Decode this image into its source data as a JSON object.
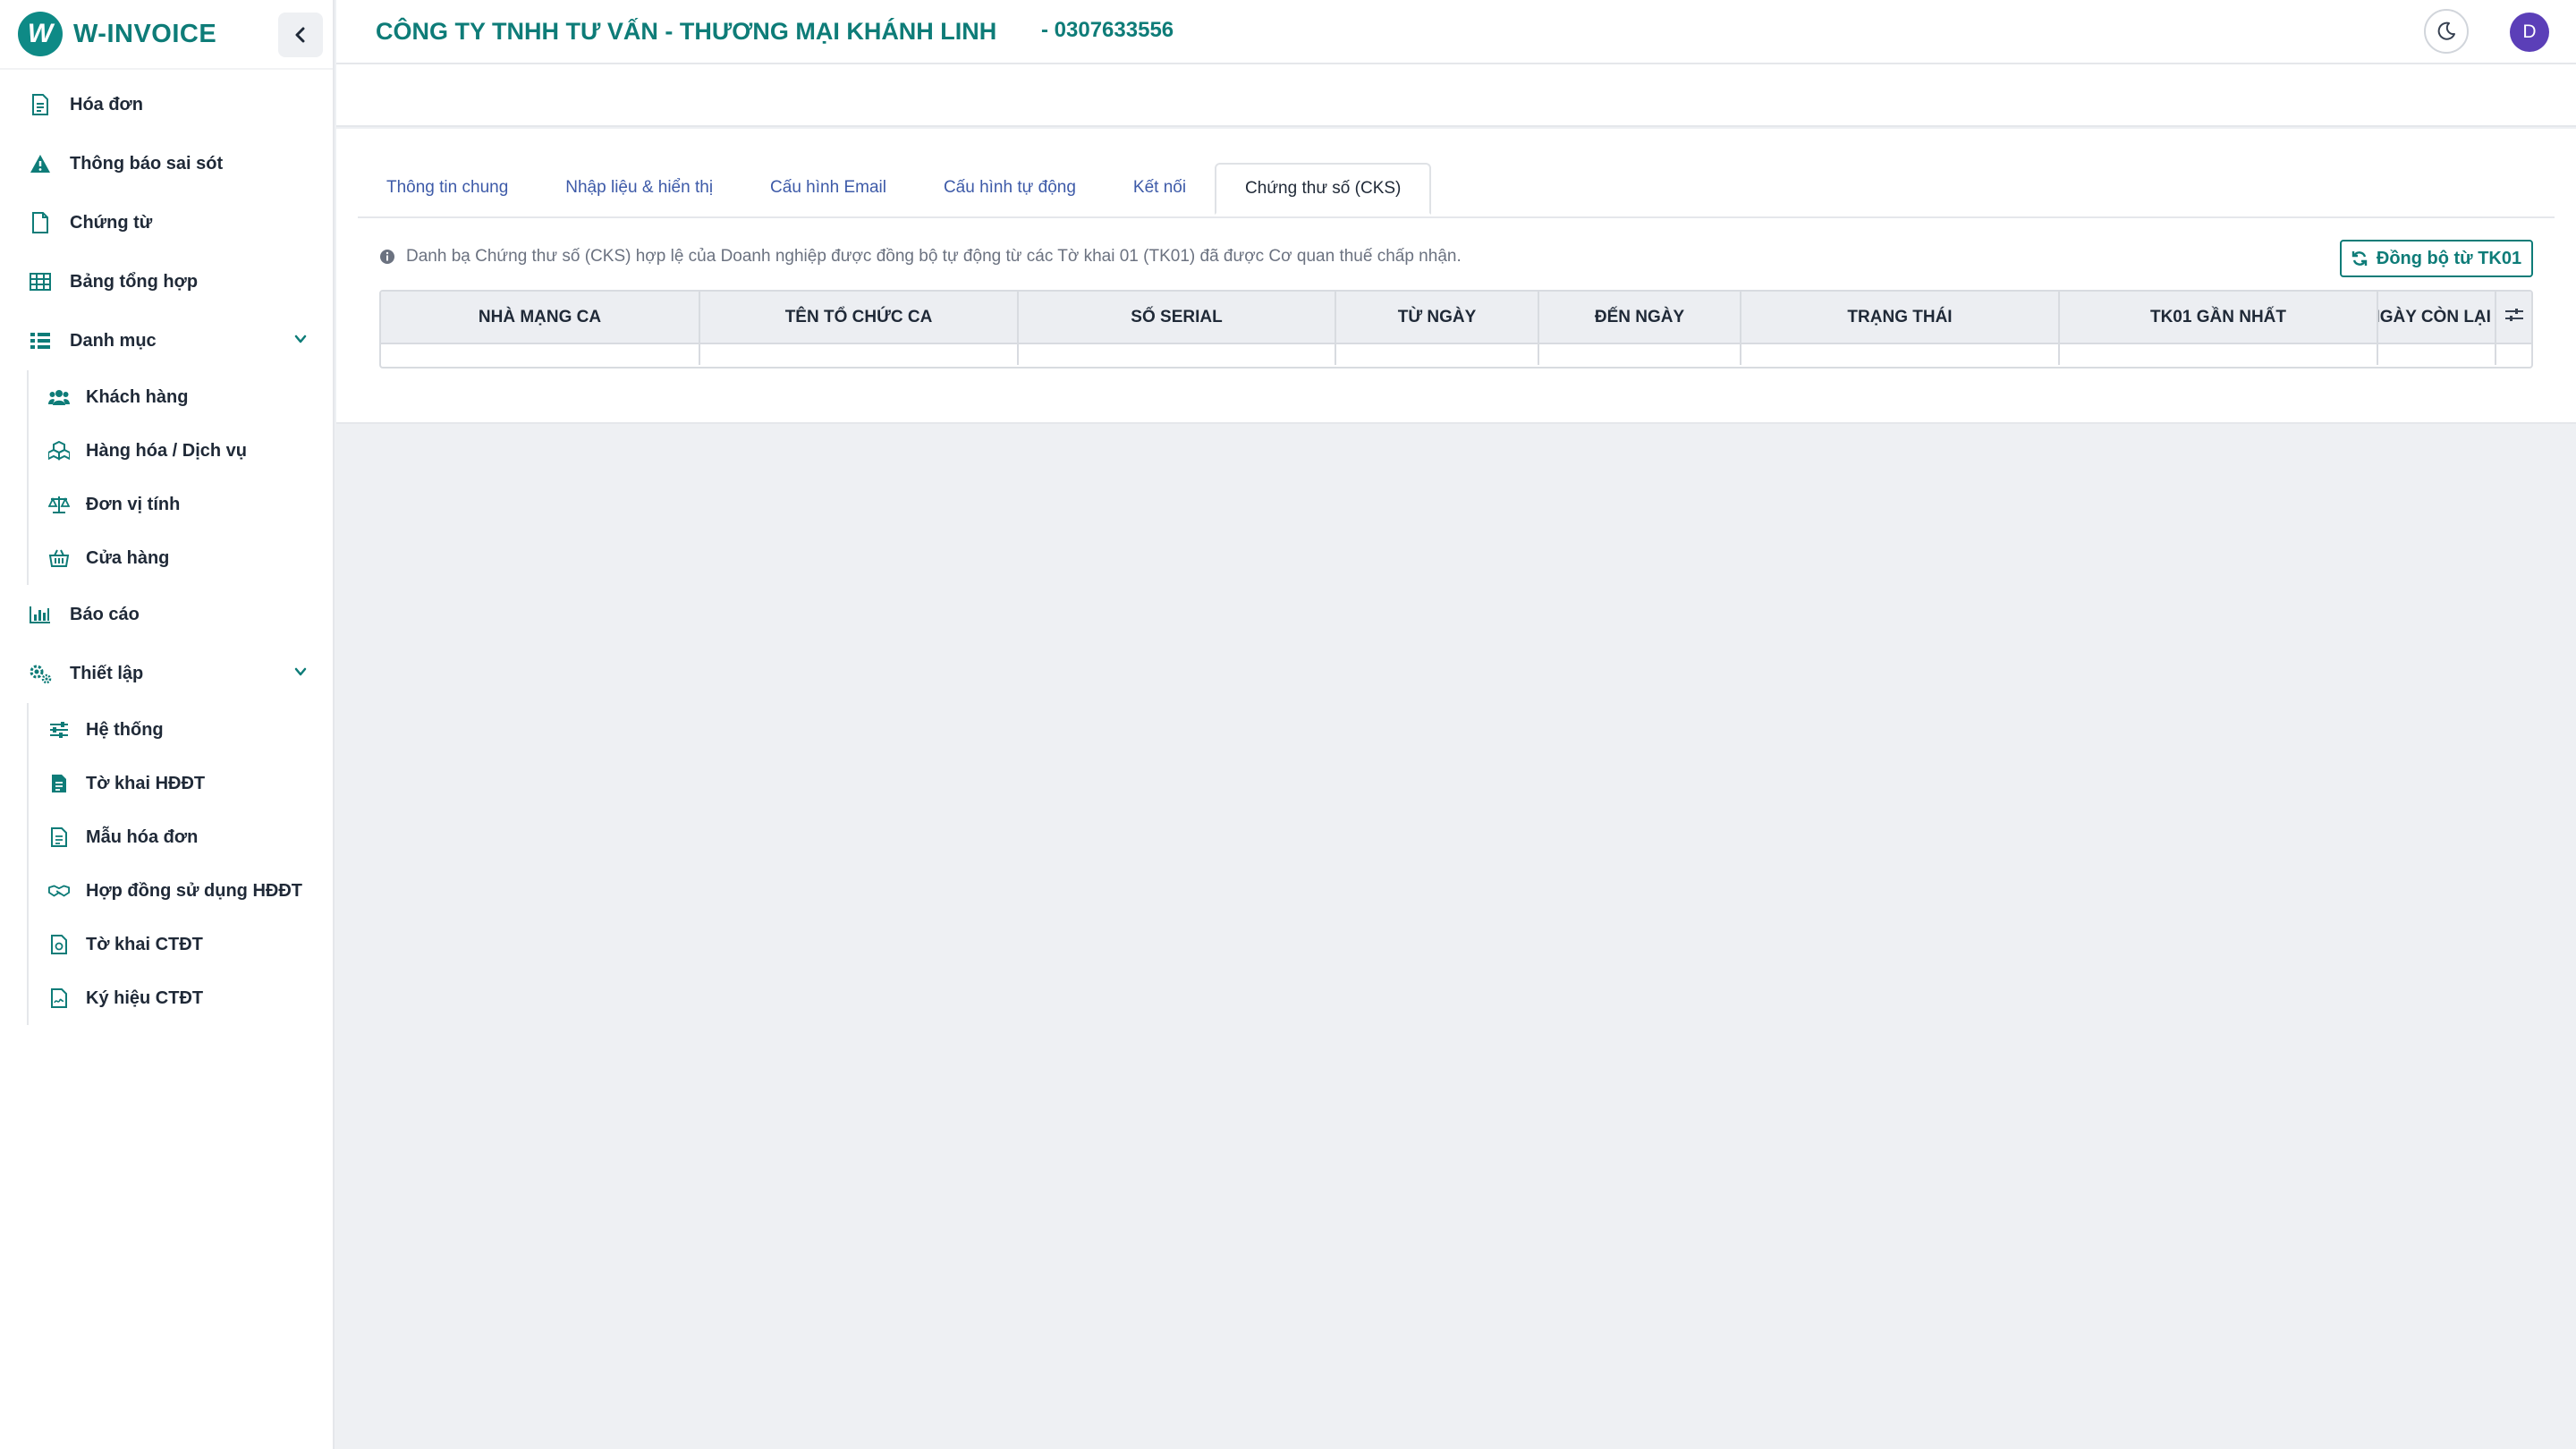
{
  "brand": {
    "name": "W-INVOICE",
    "logo_letter": "W"
  },
  "sidebar": {
    "items": [
      {
        "label": "Hóa đơn",
        "icon": "file-invoice-icon"
      },
      {
        "label": "Thông báo sai sót",
        "icon": "warning-icon"
      },
      {
        "label": "Chứng từ",
        "icon": "file-icon"
      },
      {
        "label": "Bảng tổng hợp",
        "icon": "table-icon"
      },
      {
        "label": "Danh mục",
        "icon": "list-icon",
        "expanded": true,
        "children": [
          {
            "label": "Khách hàng",
            "icon": "users-icon"
          },
          {
            "label": "Hàng hóa / Dịch vụ",
            "icon": "boxes-icon"
          },
          {
            "label": "Đơn vị tính",
            "icon": "scale-icon"
          },
          {
            "label": "Cửa hàng",
            "icon": "store-icon"
          }
        ]
      },
      {
        "label": "Báo cáo",
        "icon": "chart-icon"
      },
      {
        "label": "Thiết lập",
        "icon": "gears-icon",
        "expanded": true,
        "children": [
          {
            "label": "Hệ thống",
            "icon": "sliders-icon"
          },
          {
            "label": "Tờ khai HĐĐT",
            "icon": "file-text-icon"
          },
          {
            "label": "Mẫu hóa đơn",
            "icon": "file-alt-icon"
          },
          {
            "label": "Hợp đồng sử dụng HĐĐT",
            "icon": "handshake-icon"
          },
          {
            "label": "Tờ khai CTĐT",
            "icon": "file-contract-icon"
          },
          {
            "label": "Ký hiệu CTĐT",
            "icon": "file-signature-icon"
          }
        ]
      }
    ]
  },
  "header": {
    "company": "CÔNG TY TNHH TƯ VẤN - THƯƠNG MẠI KHÁNH LINH",
    "tax_code": "- 0307633556",
    "avatar_letter": "D"
  },
  "tabs": [
    {
      "label": "Thông tin chung",
      "active": false
    },
    {
      "label": "Nhập liệu & hiển thị",
      "active": false
    },
    {
      "label": "Cấu hình Email",
      "active": false
    },
    {
      "label": "Cấu hình tự động",
      "active": false
    },
    {
      "label": "Kết nối",
      "active": false
    },
    {
      "label": "Chứng thư số (CKS)",
      "active": true
    }
  ],
  "info_text": "Danh bạ Chứng thư số (CKS) hợp lệ của Doanh nghiệp được đồng bộ tự động từ các Tờ khai 01 (TK01) đã được Cơ quan thuế chấp nhận.",
  "sync_button": "Đồng bộ từ TK01",
  "table": {
    "columns": [
      "NHÀ MẠNG CA",
      "TÊN TỔ CHỨC CA",
      "SỐ SERIAL",
      "TỪ NGÀY",
      "ĐẾN NGÀY",
      "TRẠNG THÁI",
      "TK01 GẦN NHẤT",
      "NGÀY CÒN LẠI"
    ]
  }
}
